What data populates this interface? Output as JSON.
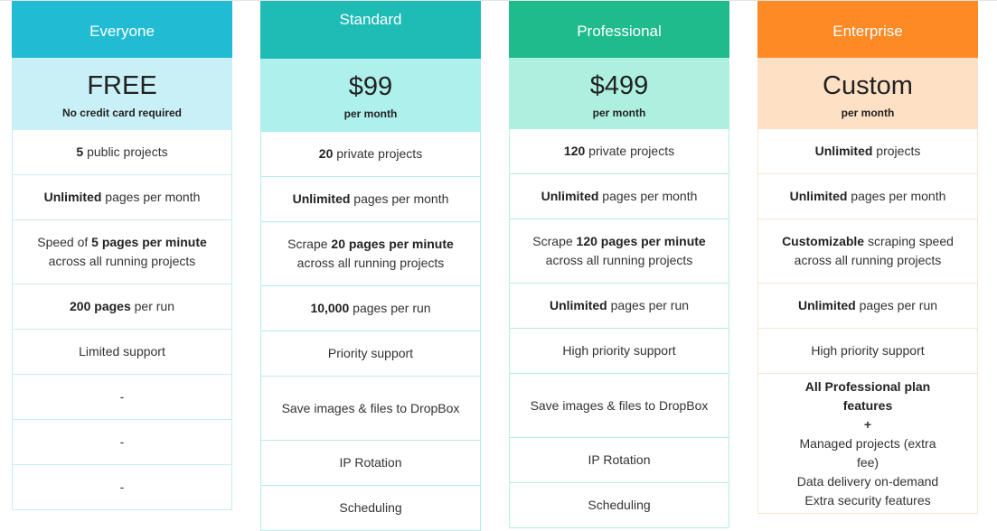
{
  "plans": [
    {
      "name": "Everyone",
      "price": "FREE",
      "price_note": "No credit card required",
      "header_color": "#21bcd3",
      "price_bg": "#c8f0f6",
      "border_color": "#c8ecf2",
      "features": [
        {
          "bold": "5",
          "text": " public projects"
        },
        {
          "bold": "Unlimited",
          "text": " pages per month"
        },
        {
          "pre": "Speed of ",
          "bold": "5 pages per minute",
          "text": " across all running projects"
        },
        {
          "bold": "200 pages",
          "text": " per run"
        },
        {
          "text": "Limited support"
        },
        {
          "text": "-"
        },
        {
          "text": "-"
        },
        {
          "text": "-"
        }
      ]
    },
    {
      "name": "Standard",
      "price": "$99",
      "price_note": "per month",
      "header_color": "#1fbcb6",
      "price_bg": "#aef0ec",
      "border_color": "#b4ecea",
      "features": [
        {
          "bold": "20",
          "text": " private projects"
        },
        {
          "bold": "Unlimited",
          "text": " pages per month"
        },
        {
          "pre": "Scrape ",
          "bold": "20 pages per minute",
          "text": " across all running projects"
        },
        {
          "bold": "10,000",
          "text": " pages per run"
        },
        {
          "text": "Priority support"
        },
        {
          "text": "Save images & files to DropBox"
        },
        {
          "text": "IP Rotation"
        },
        {
          "text": "Scheduling"
        }
      ]
    },
    {
      "name": "Professional",
      "price": "$499",
      "price_note": "per month",
      "header_color": "#1fbb8d",
      "price_bg": "#aef0df",
      "border_color": "#b4ece0",
      "features": [
        {
          "bold": "120",
          "text": " private projects"
        },
        {
          "bold": "Unlimited",
          "text": " pages per month"
        },
        {
          "pre": "Scrape ",
          "bold": "120 pages per minute",
          "text": " across all running projects"
        },
        {
          "bold": "Unlimited",
          "text": " pages per run"
        },
        {
          "text": "High priority support"
        },
        {
          "text": "Save images & files to DropBox"
        },
        {
          "text": "IP Rotation"
        },
        {
          "text": "Scheduling"
        }
      ]
    },
    {
      "name": "Enterprise",
      "price": "Custom",
      "price_note": "per month",
      "header_color": "#fd8a25",
      "price_bg": "#fee0c5",
      "border_color": "#f8e4d0",
      "features": [
        {
          "bold": "Unlimited",
          "text": " projects"
        },
        {
          "bold": "Unlimited",
          "text": " pages per month"
        },
        {
          "bold": "Customizable",
          "text": " scraping speed across all running projects"
        },
        {
          "bold": "Unlimited",
          "text": " pages per run"
        },
        {
          "text": "High priority support"
        },
        {
          "bold": "All Professional plan features",
          "plus": "+",
          "lines": [
            "Managed projects (extra fee)",
            "Data delivery on-demand",
            "Extra security features"
          ]
        }
      ]
    }
  ]
}
